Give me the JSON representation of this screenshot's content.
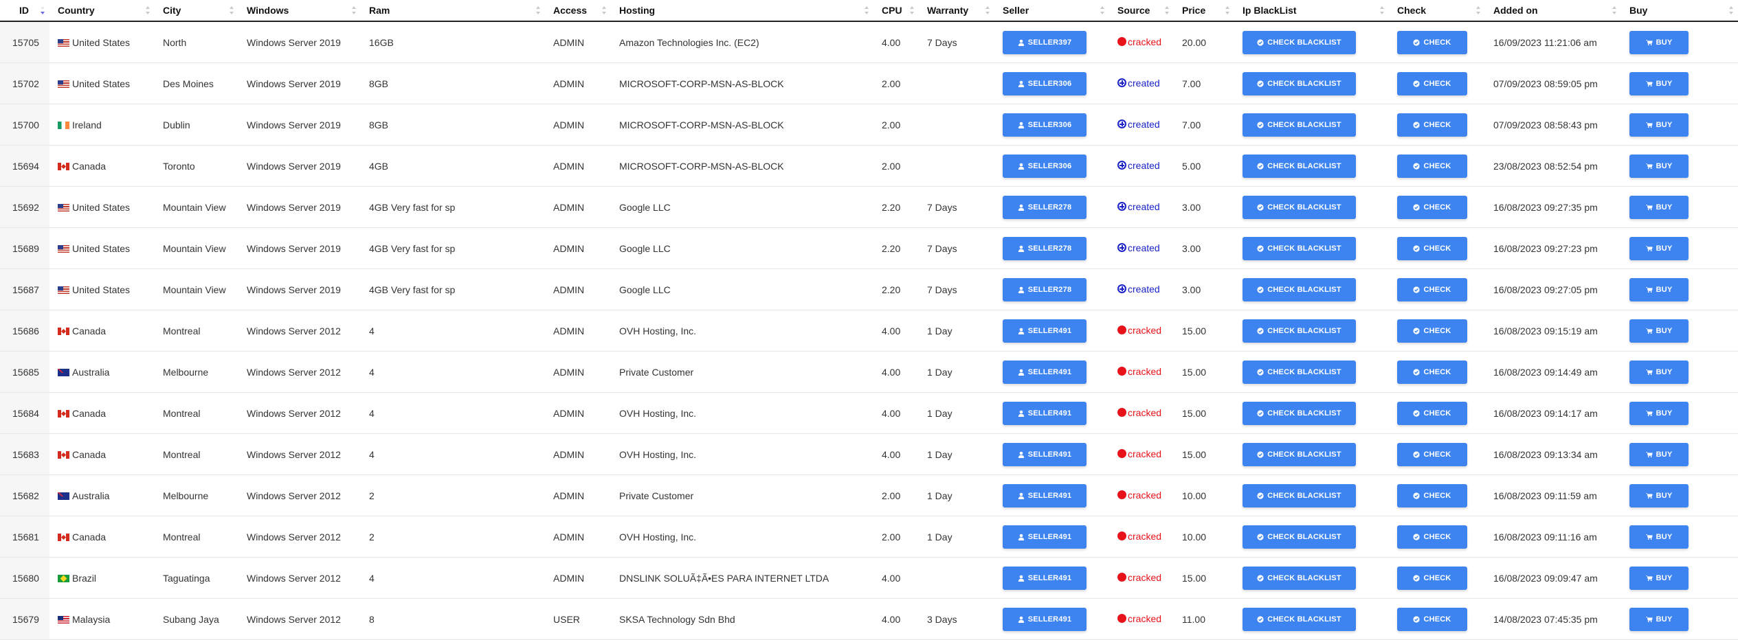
{
  "columns": [
    "ID",
    "Country",
    "City",
    "Windows",
    "Ram",
    "Access",
    "Hosting",
    "CPU",
    "Warranty",
    "Seller",
    "Source",
    "Price",
    "Ip BlackList",
    "Check",
    "Added on",
    "Buy"
  ],
  "labels": {
    "check_blacklist": "CHECK BLACKLIST",
    "check": "CHECK",
    "buy": "BUY"
  },
  "rows": [
    {
      "id": "15705",
      "flag": "us",
      "country": "United States",
      "city": "North",
      "windows": "Windows Server 2019",
      "ram": "16GB",
      "access": "ADMIN",
      "hosting": "Amazon Technologies Inc. (EC2)",
      "cpu": "4.00",
      "warranty": "7 Days",
      "seller": "SELLER397",
      "source": "cracked",
      "price": "20.00",
      "added": "16/09/2023 11:21:06 am"
    },
    {
      "id": "15702",
      "flag": "us",
      "country": "United States",
      "city": "Des Moines",
      "windows": "Windows Server 2019",
      "ram": "8GB",
      "access": "ADMIN",
      "hosting": "MICROSOFT-CORP-MSN-AS-BLOCK",
      "cpu": "2.00",
      "warranty": "",
      "seller": "SELLER306",
      "source": "created",
      "price": "7.00",
      "added": "07/09/2023 08:59:05 pm"
    },
    {
      "id": "15700",
      "flag": "ie",
      "country": "Ireland",
      "city": "Dublin",
      "windows": "Windows Server 2019",
      "ram": "8GB",
      "access": "ADMIN",
      "hosting": "MICROSOFT-CORP-MSN-AS-BLOCK",
      "cpu": "2.00",
      "warranty": "",
      "seller": "SELLER306",
      "source": "created",
      "price": "7.00",
      "added": "07/09/2023 08:58:43 pm"
    },
    {
      "id": "15694",
      "flag": "ca",
      "country": "Canada",
      "city": "Toronto",
      "windows": "Windows Server 2019",
      "ram": "4GB",
      "access": "ADMIN",
      "hosting": "MICROSOFT-CORP-MSN-AS-BLOCK",
      "cpu": "2.00",
      "warranty": "",
      "seller": "SELLER306",
      "source": "created",
      "price": "5.00",
      "added": "23/08/2023 08:52:54 pm"
    },
    {
      "id": "15692",
      "flag": "us",
      "country": "United States",
      "city": "Mountain View",
      "windows": "Windows Server 2019",
      "ram": "4GB Very fast for sp",
      "access": "ADMIN",
      "hosting": "Google LLC",
      "cpu": "2.20",
      "warranty": "7 Days",
      "seller": "SELLER278",
      "source": "created",
      "price": "3.00",
      "added": "16/08/2023 09:27:35 pm"
    },
    {
      "id": "15689",
      "flag": "us",
      "country": "United States",
      "city": "Mountain View",
      "windows": "Windows Server 2019",
      "ram": "4GB Very fast for sp",
      "access": "ADMIN",
      "hosting": "Google LLC",
      "cpu": "2.20",
      "warranty": "7 Days",
      "seller": "SELLER278",
      "source": "created",
      "price": "3.00",
      "added": "16/08/2023 09:27:23 pm"
    },
    {
      "id": "15687",
      "flag": "us",
      "country": "United States",
      "city": "Mountain View",
      "windows": "Windows Server 2019",
      "ram": "4GB Very fast for sp",
      "access": "ADMIN",
      "hosting": "Google LLC",
      "cpu": "2.20",
      "warranty": "7 Days",
      "seller": "SELLER278",
      "source": "created",
      "price": "3.00",
      "added": "16/08/2023 09:27:05 pm"
    },
    {
      "id": "15686",
      "flag": "ca",
      "country": "Canada",
      "city": "Montreal",
      "windows": "Windows Server 2012",
      "ram": "4",
      "access": "ADMIN",
      "hosting": "OVH Hosting, Inc.",
      "cpu": "4.00",
      "warranty": "1 Day",
      "seller": "SELLER491",
      "source": "cracked",
      "price": "15.00",
      "added": "16/08/2023 09:15:19 am"
    },
    {
      "id": "15685",
      "flag": "au",
      "country": "Australia",
      "city": "Melbourne",
      "windows": "Windows Server 2012",
      "ram": "4",
      "access": "ADMIN",
      "hosting": "Private Customer",
      "cpu": "4.00",
      "warranty": "1 Day",
      "seller": "SELLER491",
      "source": "cracked",
      "price": "15.00",
      "added": "16/08/2023 09:14:49 am"
    },
    {
      "id": "15684",
      "flag": "ca",
      "country": "Canada",
      "city": "Montreal",
      "windows": "Windows Server 2012",
      "ram": "4",
      "access": "ADMIN",
      "hosting": "OVH Hosting, Inc.",
      "cpu": "4.00",
      "warranty": "1 Day",
      "seller": "SELLER491",
      "source": "cracked",
      "price": "15.00",
      "added": "16/08/2023 09:14:17 am"
    },
    {
      "id": "15683",
      "flag": "ca",
      "country": "Canada",
      "city": "Montreal",
      "windows": "Windows Server 2012",
      "ram": "4",
      "access": "ADMIN",
      "hosting": "OVH Hosting, Inc.",
      "cpu": "4.00",
      "warranty": "1 Day",
      "seller": "SELLER491",
      "source": "cracked",
      "price": "15.00",
      "added": "16/08/2023 09:13:34 am"
    },
    {
      "id": "15682",
      "flag": "au",
      "country": "Australia",
      "city": "Melbourne",
      "windows": "Windows Server 2012",
      "ram": "2",
      "access": "ADMIN",
      "hosting": "Private Customer",
      "cpu": "2.00",
      "warranty": "1 Day",
      "seller": "SELLER491",
      "source": "cracked",
      "price": "10.00",
      "added": "16/08/2023 09:11:59 am"
    },
    {
      "id": "15681",
      "flag": "ca",
      "country": "Canada",
      "city": "Montreal",
      "windows": "Windows Server 2012",
      "ram": "2",
      "access": "ADMIN",
      "hosting": "OVH Hosting, Inc.",
      "cpu": "2.00",
      "warranty": "1 Day",
      "seller": "SELLER491",
      "source": "cracked",
      "price": "10.00",
      "added": "16/08/2023 09:11:16 am"
    },
    {
      "id": "15680",
      "flag": "br",
      "country": "Brazil",
      "city": "Taguatinga",
      "windows": "Windows Server 2012",
      "ram": "4",
      "access": "ADMIN",
      "hosting": "DNSLINK SOLUÃ‡Ã•ES PARA INTERNET LTDA",
      "cpu": "4.00",
      "warranty": "",
      "seller": "SELLER491",
      "source": "cracked",
      "price": "15.00",
      "added": "16/08/2023 09:09:47 am"
    },
    {
      "id": "15679",
      "flag": "my",
      "country": "Malaysia",
      "city": "Subang Jaya",
      "windows": "Windows Server 2012",
      "ram": "8",
      "access": "USER",
      "hosting": "SKSA Technology Sdn Bhd",
      "cpu": "4.00",
      "warranty": "3 Days",
      "seller": "SELLER491",
      "source": "cracked",
      "price": "11.00",
      "added": "14/08/2023 07:45:35 pm"
    }
  ]
}
